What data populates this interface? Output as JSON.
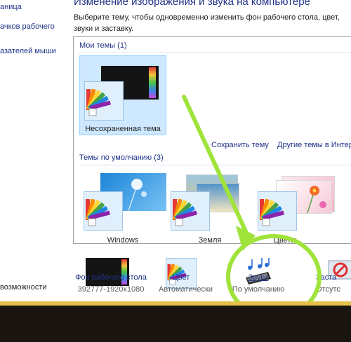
{
  "left_nav": {
    "items": [
      {
        "label": "аница",
        "link": true
      },
      {
        "label": "ачков рабочего",
        "link": true
      },
      {
        "label": "азателей мыши",
        "link": true
      }
    ],
    "footer_label": "возможности"
  },
  "main": {
    "title": "Изменение изображения и звука на компьютере",
    "description": "Выберите тему, чтобы одновременно изменить фон рабочего стола, цвет, звуки и заставку."
  },
  "my_themes": {
    "title": "Мои темы (1)",
    "items": [
      {
        "label": "Несохраненная тема",
        "selected": true
      }
    ],
    "save_link": "Сохранить тему",
    "more_link": "Другие темы в Интерне"
  },
  "default_themes": {
    "title": "Темы по умолчанию (3)",
    "items": [
      {
        "label": "Windows"
      },
      {
        "label": "Земля"
      },
      {
        "label": "Цветы"
      }
    ]
  },
  "bottom_bar": {
    "items": [
      {
        "name": "Фон рабочего стола",
        "sub": "392777-1920x1080"
      },
      {
        "name": "Цвет",
        "sub": "Автоматически"
      },
      {
        "name": "Звуки",
        "sub": "По умолчанию"
      },
      {
        "name": "Заста",
        "sub": "Отсутс"
      }
    ]
  },
  "colors": {
    "accent_link": "#1e3287",
    "annotation_green": "#9fe33b",
    "selection_bg": "#cde8ff"
  }
}
